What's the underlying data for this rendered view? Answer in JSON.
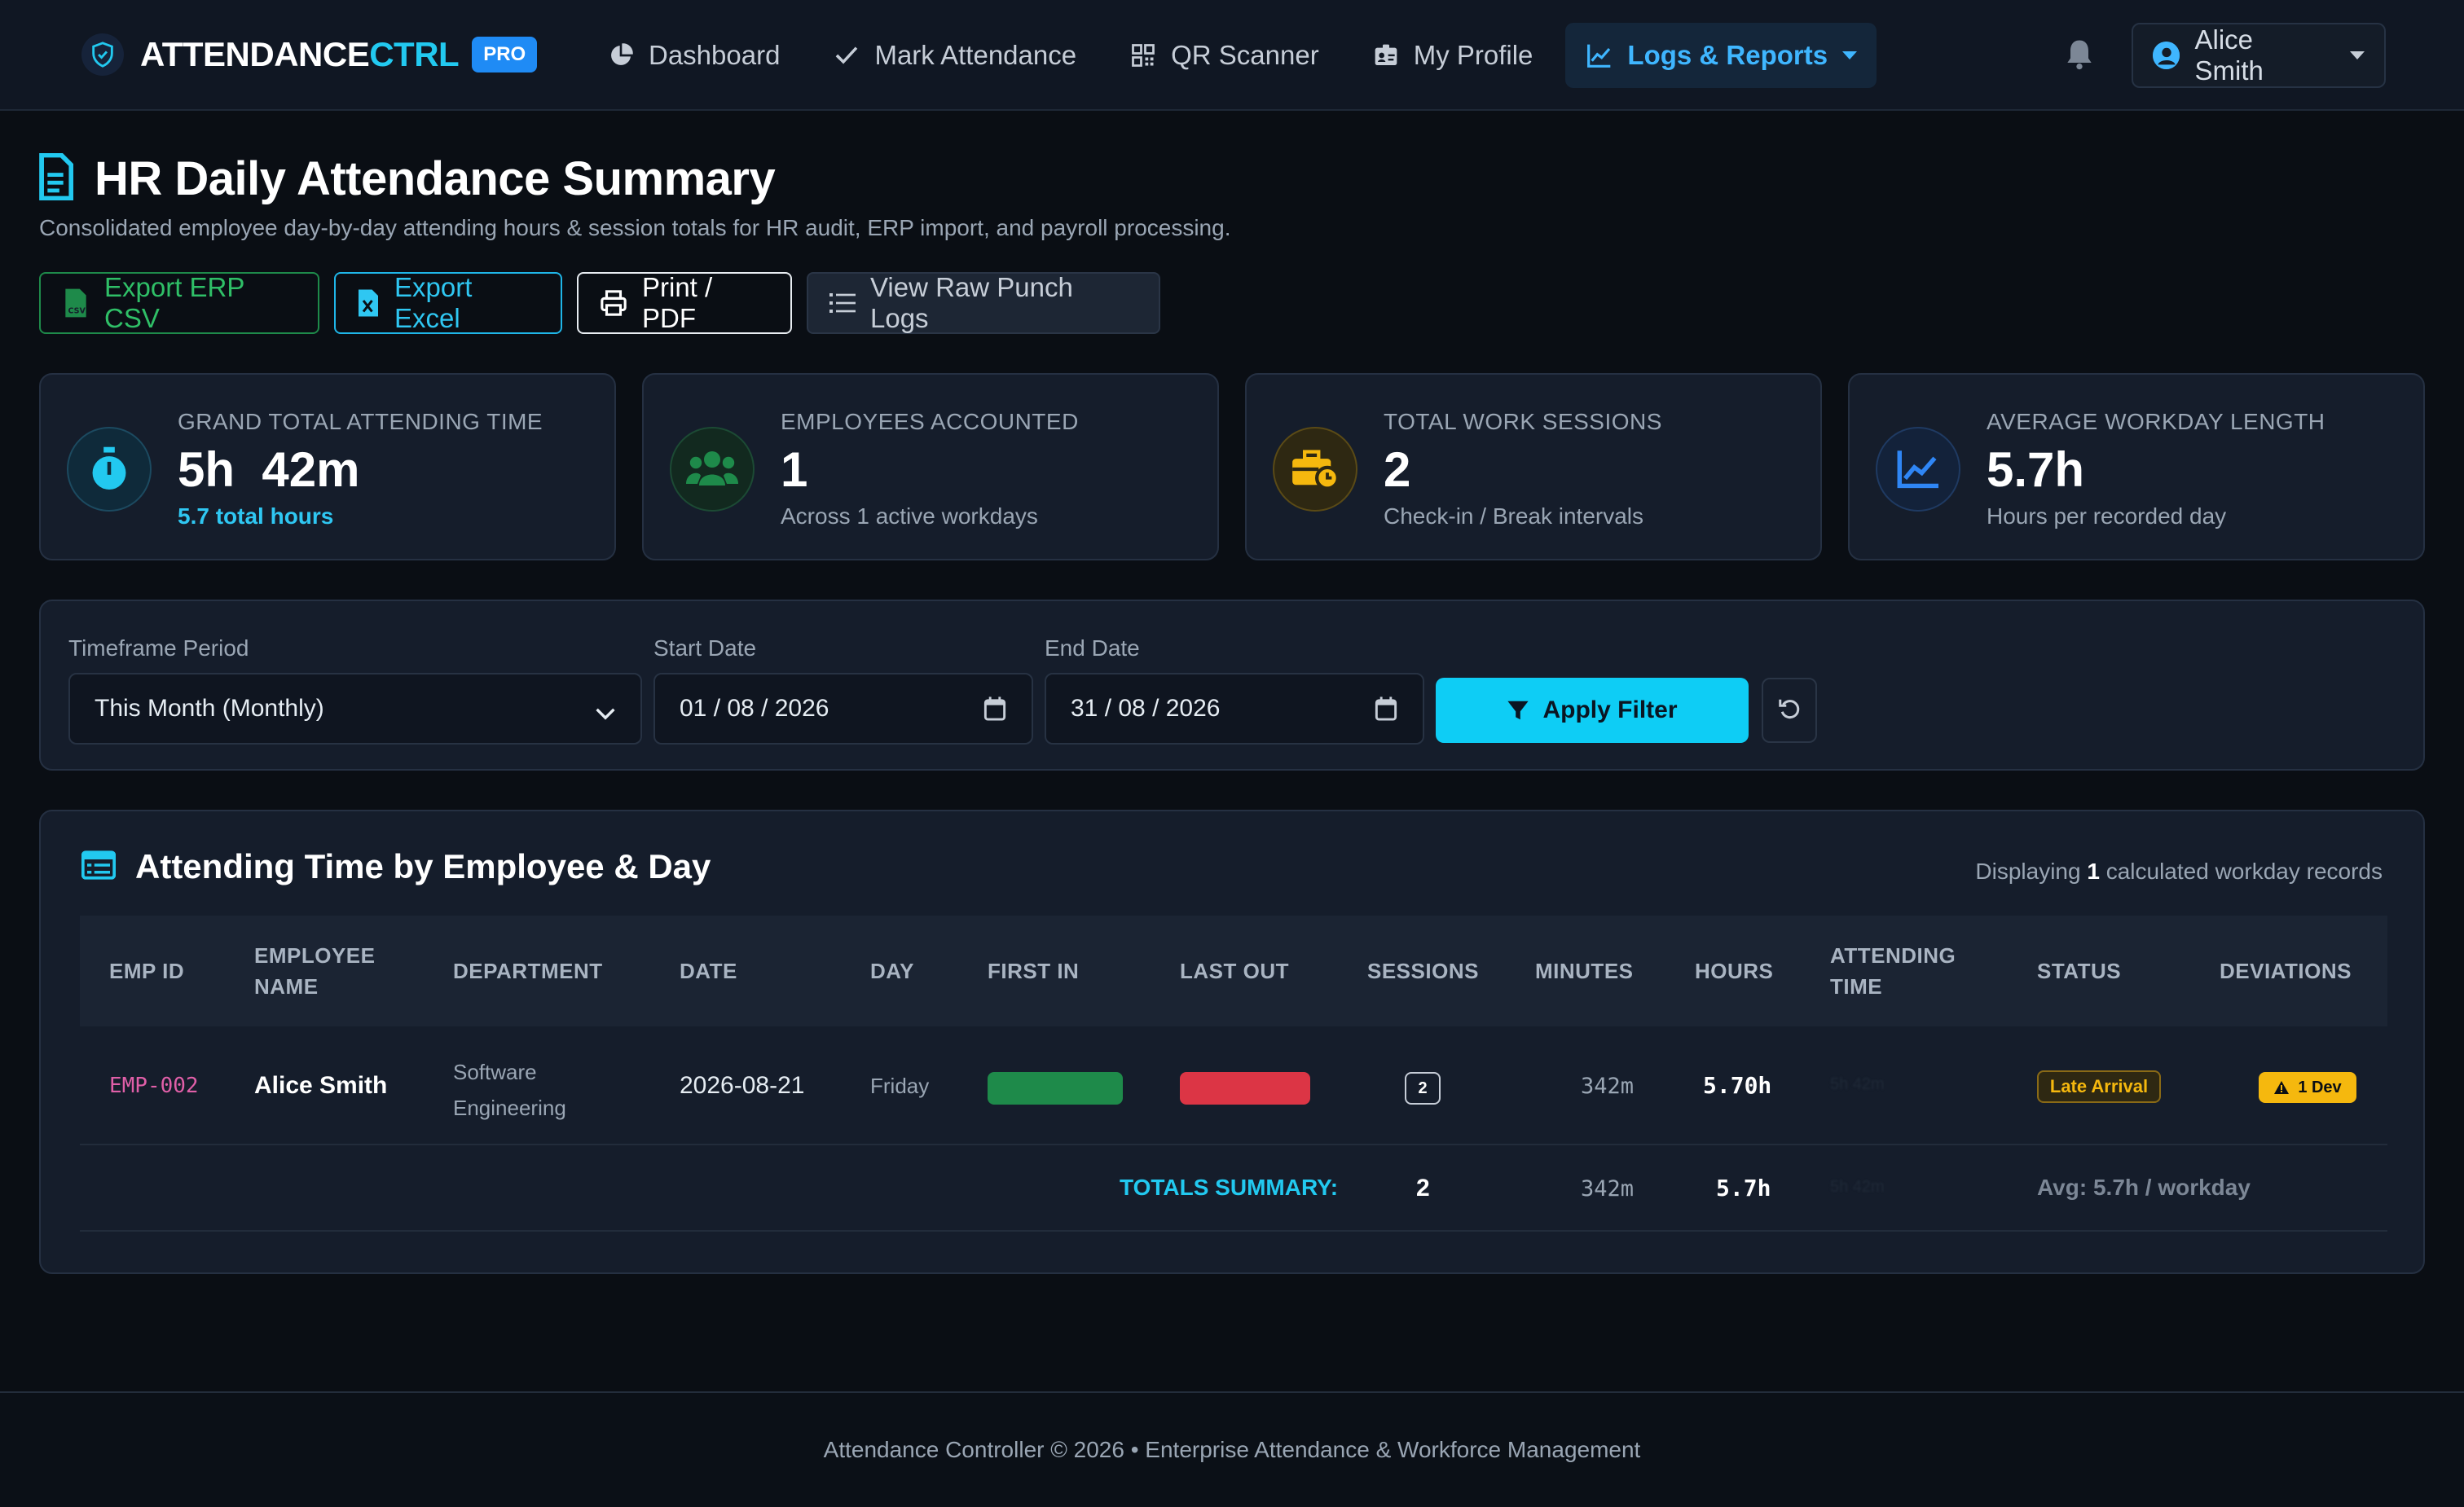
{
  "colors": {
    "accent": "#22c9f0",
    "brand_badge": "#1f8bf5",
    "success": "#1e8a4a",
    "danger": "#dc3545",
    "warning": "#f5b80e"
  },
  "navbar": {
    "brand_main": "ATTENDANCE",
    "brand_accent": "CTRL",
    "badge": "PRO",
    "items": [
      {
        "label": "Dashboard",
        "icon": "pie-chart-icon"
      },
      {
        "label": "Mark Attendance",
        "icon": "check-icon"
      },
      {
        "label": "QR Scanner",
        "icon": "qr-code-icon"
      },
      {
        "label": "My Profile",
        "icon": "id-badge-icon"
      },
      {
        "label": "Logs & Reports",
        "icon": "line-chart-icon",
        "active": true
      }
    ],
    "user_name": "Alice Smith"
  },
  "header": {
    "title": "HR Daily Attendance Summary",
    "subtitle": "Consolidated employee day-by-day attending hours & session totals for HR audit, ERP import, and payroll processing.",
    "actions": {
      "export_csv": "Export ERP CSV",
      "export_excel": "Export Excel",
      "print": "Print / PDF",
      "raw_logs": "View Raw Punch Logs"
    }
  },
  "stats": [
    {
      "label": "Grand Total Attending Time",
      "value": "5h  42m",
      "sub": "5.7 total hours",
      "icon": "stopwatch-icon"
    },
    {
      "label": "Employees Accounted",
      "value": "1",
      "sub": "Across 1 active workdays",
      "icon": "users-icon"
    },
    {
      "label": "Total Work Sessions",
      "value": "2",
      "sub": "Check-in / Break intervals",
      "icon": "briefcase-clock-icon"
    },
    {
      "label": "Average Workday Length",
      "value": "5.7h",
      "sub": "Hours per recorded day",
      "icon": "trend-chart-icon"
    }
  ],
  "filter": {
    "timeframe_label": "Timeframe Period",
    "timeframe_value": "This Month (Monthly)",
    "start_label": "Start Date",
    "start_value": "01 / 08 / 2026",
    "end_label": "End Date",
    "end_value": "31 / 08 / 2026",
    "apply_label": "Apply Filter"
  },
  "table": {
    "title": "Attending Time by Employee & Day",
    "meta_prefix": "Displaying",
    "meta_count": "1",
    "meta_suffix": "calculated workday records",
    "columns": {
      "emp_id": "EMP ID",
      "emp_name_1": "EMPLOYEE",
      "emp_name_2": "NAME",
      "department": "DEPARTMENT",
      "date": "DATE",
      "day": "DAY",
      "first_in": "FIRST IN",
      "last_out": "LAST OUT",
      "sessions": "SESSIONS",
      "minutes": "MINUTES",
      "hours": "HOURS",
      "attending_1": "ATTENDING",
      "attending_2": "TIME",
      "status": "STATUS",
      "deviations": "DEVIATIONS"
    },
    "rows": [
      {
        "emp_id": "EMP-002",
        "name": "Alice Smith",
        "dept_1": "Software",
        "dept_2": "Engineering",
        "date": "2026-08-21",
        "day": "Friday",
        "sessions": "2",
        "minutes": "342m",
        "hours": "5.70h",
        "attending": "5h 42m",
        "status": "Late Arrival",
        "deviation": "1 Dev"
      }
    ],
    "totals": {
      "label": "TOTALS SUMMARY:",
      "sessions": "2",
      "minutes": "342m",
      "hours": "5.7h",
      "attending": "5h 42m",
      "avg": "Avg: 5.7h / workday"
    }
  },
  "footer": {
    "text": "Attendance Controller © 2026 • Enterprise Attendance & Workforce Management"
  }
}
